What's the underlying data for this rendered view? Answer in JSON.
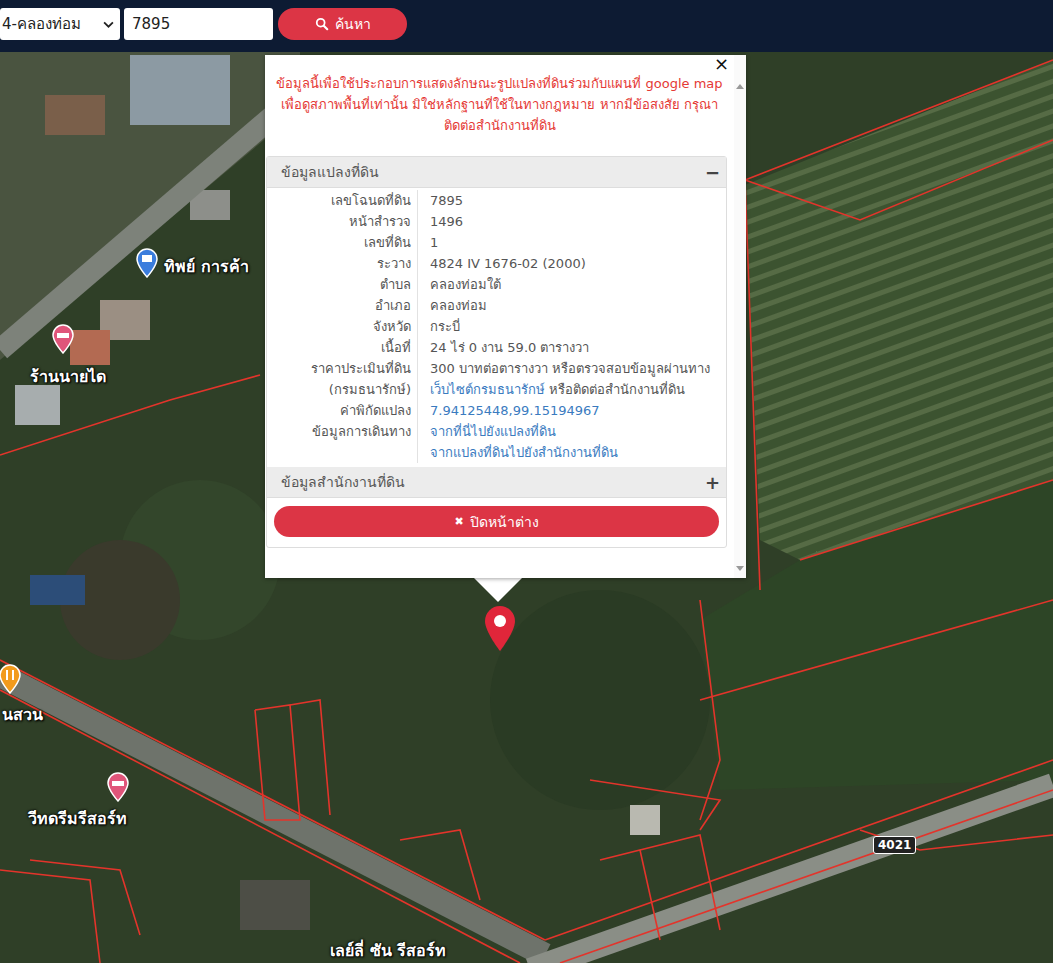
{
  "search_bar": {
    "district": "4-คลองท่อม",
    "query": "7895",
    "button": "ค้นหา"
  },
  "popup": {
    "close": "×",
    "notice": "ข้อมูลนี้เพื่อใช้ประกอบการแสดงลักษณะรูปแปลงที่ดินร่วมกับแผนที่ google map เพื่อดูสภาพพื้นที่เท่านั้น มิใช่หลักฐานที่ใช้ในทางกฎหมาย หากมีข้อสงสัย กรุณาติดต่อสำนักงานที่ดิน",
    "sections": [
      {
        "title": "ข้อมูลแปลงที่ดิน",
        "toggle": "−",
        "expanded": true,
        "rows": [
          {
            "label": [
              "เลขโฉนดที่ดิน"
            ],
            "value": [
              [
                {
                  "text": "7895",
                  "link": false
                }
              ]
            ]
          },
          {
            "label": [
              "หน้าสำรวจ"
            ],
            "value": [
              [
                {
                  "text": "1496",
                  "link": false
                }
              ]
            ]
          },
          {
            "label": [
              "เลขที่ดิน"
            ],
            "value": [
              [
                {
                  "text": "1",
                  "link": false
                }
              ]
            ]
          },
          {
            "label": [
              "ระวาง"
            ],
            "value": [
              [
                {
                  "text": "4824 IV 1676-02 (2000)",
                  "link": false
                }
              ]
            ]
          },
          {
            "label": [
              "ตำบล"
            ],
            "value": [
              [
                {
                  "text": "คลองท่อมใต้",
                  "link": false
                }
              ]
            ]
          },
          {
            "label": [
              "อำเภอ"
            ],
            "value": [
              [
                {
                  "text": "คลองท่อม",
                  "link": false
                }
              ]
            ]
          },
          {
            "label": [
              "จังหวัด"
            ],
            "value": [
              [
                {
                  "text": "กระบี่",
                  "link": false
                }
              ]
            ]
          },
          {
            "label": [
              "เนื้อที่"
            ],
            "value": [
              [
                {
                  "text": "24 ไร่ 0 งาน 59.0 ตารางวา",
                  "link": false
                }
              ]
            ]
          },
          {
            "label": [
              "ราคาประเมินที่ดิน",
              "(กรมธนารักษ์)"
            ],
            "value": [
              [
                {
                  "text": "300 บาทต่อตารางวา หรือตรวจสอบข้อมูลผ่านทาง",
                  "link": false
                }
              ],
              [
                {
                  "text": "เว็บไซต์กรมธนารักษ์",
                  "link": true
                },
                {
                  "text": " หรือติดต่อสำนักงานที่ดิน",
                  "link": false
                }
              ]
            ]
          },
          {
            "label": [
              "ค่าพิกัดแปลง"
            ],
            "value": [
              [
                {
                  "text": "7.94125448,99.15194967",
                  "link": true
                }
              ]
            ]
          },
          {
            "label": [
              "ข้อมูลการเดินทาง"
            ],
            "value": [
              [
                {
                  "text": "จากที่นี่ไปยังแปลงที่ดิน",
                  "link": true
                }
              ],
              [
                {
                  "text": "จากแปลงที่ดินไปยังสำนักงานที่ดิน",
                  "link": true
                }
              ]
            ]
          }
        ]
      },
      {
        "title": "ข้อมูลสำนักงานที่ดิน",
        "toggle": "+",
        "expanded": false,
        "rows": []
      }
    ],
    "close_button": "ปิดหน้าต่าง",
    "close_button_icon": "✖"
  },
  "map": {
    "places": [
      {
        "name": "ทิพย์ การค้า",
        "kind": "shop",
        "color": "#3b7ddd"
      },
      {
        "name": "ร้านนายได",
        "kind": "hotel",
        "color": "#e0557a"
      },
      {
        "name": "นสวน",
        "kind": "restaurant",
        "color": "#f29b1d"
      },
      {
        "name": "วีทดรีมรีสอร์ท",
        "kind": "hotel",
        "color": "#e0557a"
      },
      {
        "name": "เลย์ลี่ ซัน รีสอร์ท",
        "kind": "label",
        "color": "#ffffff"
      }
    ],
    "road_signs": [
      "4021"
    ]
  }
}
